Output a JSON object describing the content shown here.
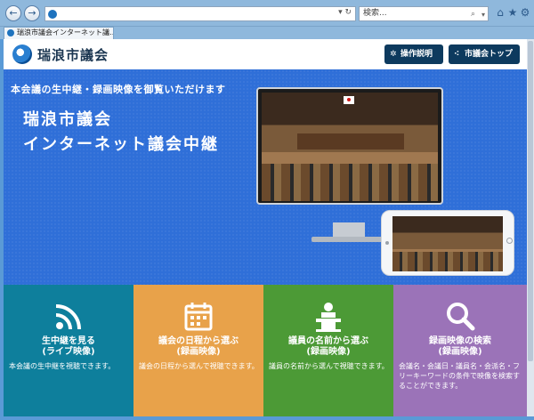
{
  "browser": {
    "back_icon": "arrow-left-icon",
    "forward_icon": "arrow-right-icon",
    "address_url": "",
    "address_controls": "▾ ↻",
    "search_placeholder": "検索...",
    "search_icon": "search-icon",
    "tab_title": "瑞浪市議会インターネット議…",
    "tab_close": "×",
    "chrome_icons": {
      "home": "home-icon",
      "favorites": "star-icon",
      "settings": "gear-icon"
    }
  },
  "header": {
    "site_title": "瑞浪市議会",
    "buttons": [
      {
        "label": "操作説明",
        "icon": "gear-icon"
      },
      {
        "label": "市議会トップへ",
        "icon": "sitemap-icon"
      }
    ]
  },
  "hero": {
    "subtitle": "本会議の生中継・録画映像を御覧いただけます",
    "title_line1": "瑞浪市議会",
    "title_line2": "インターネット議会中継"
  },
  "tiles": [
    {
      "title_line1": "生中継を見る",
      "title_line2": "(ライブ映像)",
      "desc": "本会議の生中継を視聴できます。",
      "icon": "broadcast-icon",
      "color": "#0e7f9c"
    },
    {
      "title_line1": "議会の日程から選ぶ",
      "title_line2": "(録画映像)",
      "desc": "議会の日程から選んで視聴できます。",
      "icon": "calendar-icon",
      "color": "#e8a24a"
    },
    {
      "title_line1": "議員の名前から選ぶ",
      "title_line2": "(録画映像)",
      "desc": "議員の名前から選んで視聴できます。",
      "icon": "speaker-podium-icon",
      "color": "#4c9a36"
    },
    {
      "title_line1": "録画映像の検索",
      "title_line2": "(録画映像)",
      "desc": "会議名・会議日・議員名・会派名・フリーキーワードの条件で映像を検索することができます。",
      "icon": "search-icon",
      "color": "#9b73b8"
    }
  ]
}
